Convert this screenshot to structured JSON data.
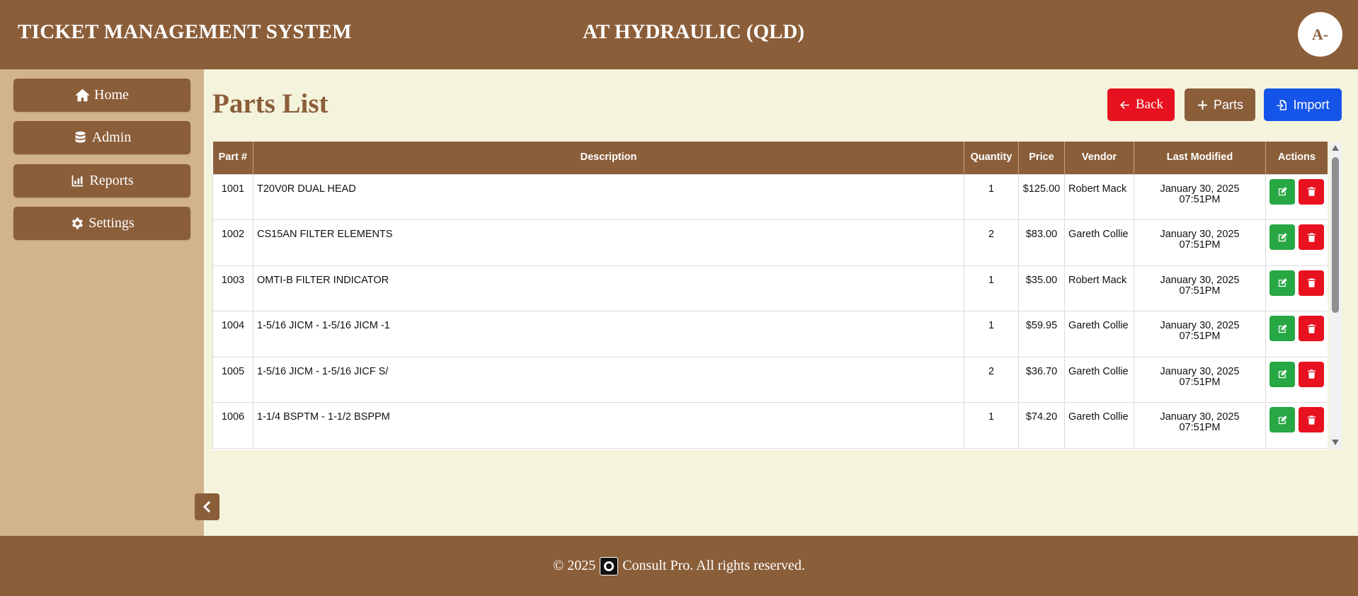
{
  "header": {
    "app_title": "TICKET MANAGEMENT SYSTEM",
    "company": "AT HYDRAULIC (QLD)",
    "avatar_initials": "A-"
  },
  "sidebar": {
    "items": [
      {
        "label": "Home",
        "icon": "home-icon"
      },
      {
        "label": "Admin",
        "icon": "database-icon"
      },
      {
        "label": "Reports",
        "icon": "chart-icon"
      },
      {
        "label": "Settings",
        "icon": "gear-icon"
      }
    ],
    "collapse_icon": "chevron-left-icon"
  },
  "page": {
    "title": "Parts List",
    "back_label": "Back",
    "parts_label": "Parts",
    "import_label": "Import"
  },
  "table": {
    "headers": [
      "Part #",
      "Description",
      "Quantity",
      "Price",
      "Vendor",
      "Last Modified",
      "Actions"
    ],
    "rows": [
      {
        "part": "1001",
        "description": "T20V0R DUAL HEAD",
        "quantity": "1",
        "price": "$125.00",
        "vendor": "Robert Mack",
        "modified_date": "January 30, 2025",
        "modified_time": "07:51PM"
      },
      {
        "part": "1002",
        "description": "CS15AN FILTER ELEMENTS",
        "quantity": "2",
        "price": "$83.00",
        "vendor": "Gareth Collie",
        "modified_date": "January 30, 2025",
        "modified_time": "07:51PM"
      },
      {
        "part": "1003",
        "description": "OMTI-B FILTER INDICATOR",
        "quantity": "1",
        "price": "$35.00",
        "vendor": "Robert Mack",
        "modified_date": "January 30, 2025",
        "modified_time": "07:51PM"
      },
      {
        "part": "1004",
        "description": "1-5/16 JICM - 1-5/16 JICM -1",
        "quantity": "1",
        "price": "$59.95",
        "vendor": "Gareth Collie",
        "modified_date": "January 30, 2025",
        "modified_time": "07:51PM"
      },
      {
        "part": "1005",
        "description": "1-5/16 JICM - 1-5/16 JICF S/",
        "quantity": "2",
        "price": "$36.70",
        "vendor": "Gareth Collie",
        "modified_date": "January 30, 2025",
        "modified_time": "07:51PM"
      },
      {
        "part": "1006",
        "description": "1-1/4 BSPTM - 1-1/2 BSPPM",
        "quantity": "1",
        "price": "$74.20",
        "vendor": "Gareth Collie",
        "modified_date": "January 30, 2025",
        "modified_time": "07:51PM"
      }
    ]
  },
  "footer": {
    "copyright": "© 2025",
    "company_text": "Consult Pro. All rights reserved."
  },
  "colors": {
    "brand": "#8b5e3a",
    "sidebar_bg": "#d2b48c",
    "content_bg": "#f4f3dc",
    "danger": "#e8111f",
    "primary": "#1454e8",
    "success": "#28a745"
  }
}
